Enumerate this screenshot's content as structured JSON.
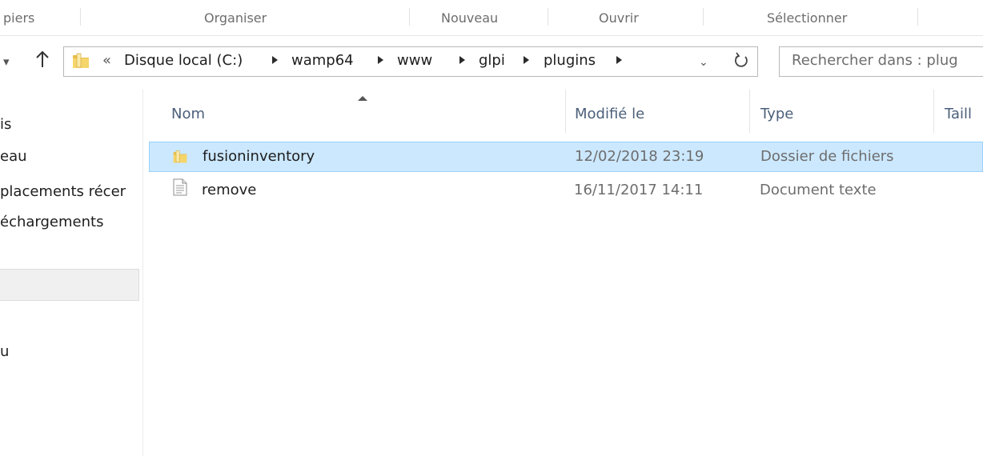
{
  "ribbon": {
    "groups": [
      "piers",
      "Organiser",
      "Nouveau",
      "Ouvrir",
      "Sélectionner"
    ]
  },
  "address": {
    "overflow": "«",
    "crumbs": [
      "Disque local (C:)",
      "wamp64",
      "www",
      "glpi",
      "plugins"
    ]
  },
  "search": {
    "placeholder": "Rechercher dans : plug"
  },
  "nav_pane": {
    "items": [
      "is",
      "eau",
      "placements récer",
      "échargements",
      "",
      "u"
    ]
  },
  "columns": {
    "name": "Nom",
    "modified": "Modifié le",
    "type": "Type",
    "size": "Taill"
  },
  "files": [
    {
      "name": "fusioninventory",
      "modified": "12/02/2018 23:19",
      "type": "Dossier de fichiers",
      "icon": "folder-icon",
      "selected": true
    },
    {
      "name": "remove",
      "modified": "16/11/2017 14:11",
      "type": "Document texte",
      "icon": "text-file-icon",
      "selected": false
    }
  ],
  "colors": {
    "selection_bg": "#cce8ff",
    "selection_border": "#99d1ff",
    "header_text": "#4c607a",
    "folder": "#e8bf4a"
  }
}
